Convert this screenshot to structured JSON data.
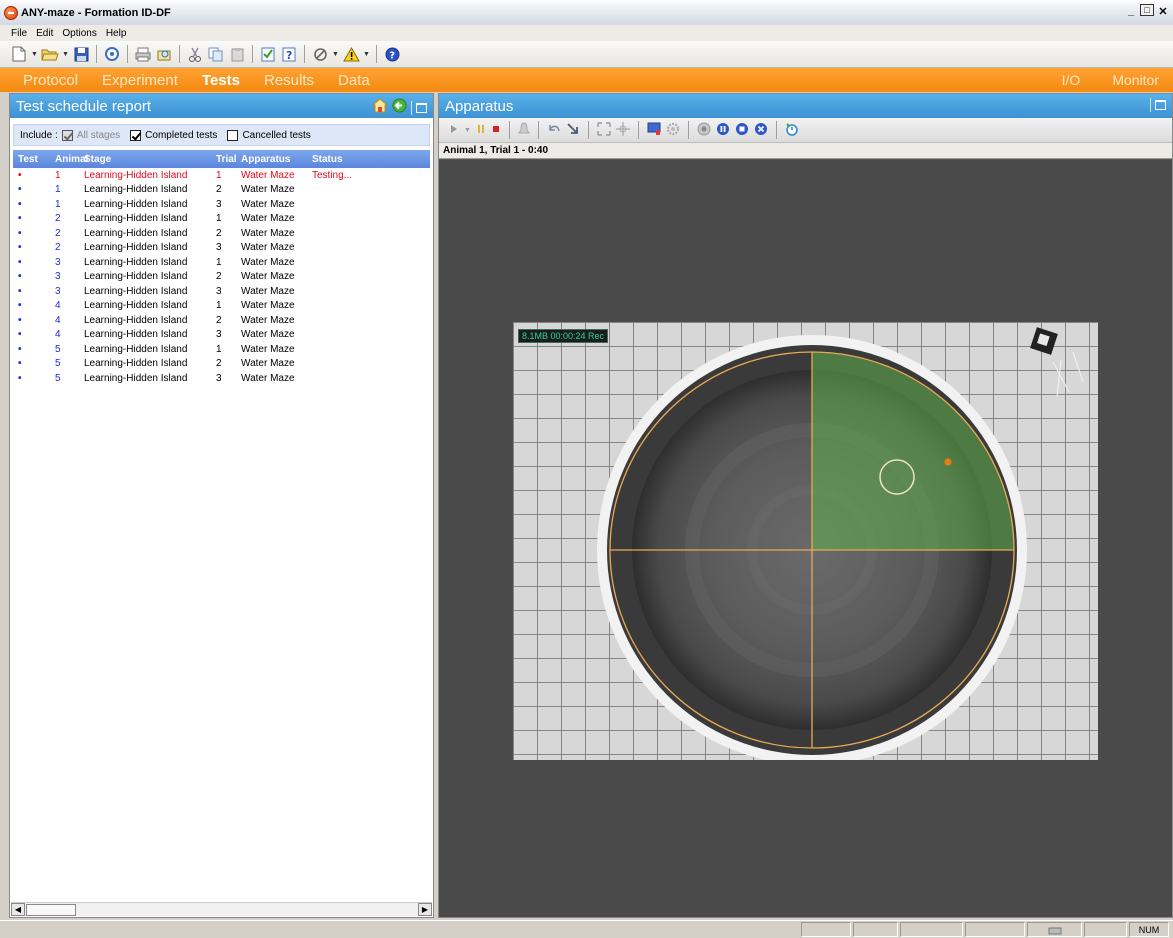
{
  "window": {
    "title": "ANY-maze - Formation ID-DF"
  },
  "menu": {
    "items": [
      "File",
      "Edit",
      "Options",
      "Help"
    ]
  },
  "nav": {
    "tabs": [
      "Protocol",
      "Experiment",
      "Tests",
      "Results",
      "Data"
    ],
    "active": "Tests",
    "right_tabs": [
      "I/O",
      "Monitor"
    ]
  },
  "left_panel": {
    "title": "Test schedule report",
    "include": {
      "label": "Include :",
      "all_stages": "All stages",
      "completed_tests": "Completed tests",
      "cancelled_tests": "Cancelled tests"
    },
    "table": {
      "headers": {
        "test": "Test",
        "animal": "Animal",
        "stage": "Stage",
        "trial": "Trial",
        "apparatus": "Apparatus",
        "status": "Status"
      },
      "rows": [
        {
          "bullet": "•",
          "animal": "1",
          "stage": "Learning-Hidden Island",
          "trial": "1",
          "apparatus": "Water Maze",
          "status": "Testing..."
        },
        {
          "bullet": "•",
          "animal": "1",
          "stage": "Learning-Hidden Island",
          "trial": "2",
          "apparatus": "Water Maze",
          "status": ""
        },
        {
          "bullet": "•",
          "animal": "1",
          "stage": "Learning-Hidden Island",
          "trial": "3",
          "apparatus": "Water Maze",
          "status": ""
        },
        {
          "bullet": "•",
          "animal": "2",
          "stage": "Learning-Hidden Island",
          "trial": "1",
          "apparatus": "Water Maze",
          "status": ""
        },
        {
          "bullet": "•",
          "animal": "2",
          "stage": "Learning-Hidden Island",
          "trial": "2",
          "apparatus": "Water Maze",
          "status": ""
        },
        {
          "bullet": "•",
          "animal": "2",
          "stage": "Learning-Hidden Island",
          "trial": "3",
          "apparatus": "Water Maze",
          "status": ""
        },
        {
          "bullet": "•",
          "animal": "3",
          "stage": "Learning-Hidden Island",
          "trial": "1",
          "apparatus": "Water Maze",
          "status": ""
        },
        {
          "bullet": "•",
          "animal": "3",
          "stage": "Learning-Hidden Island",
          "trial": "2",
          "apparatus": "Water Maze",
          "status": ""
        },
        {
          "bullet": "•",
          "animal": "3",
          "stage": "Learning-Hidden Island",
          "trial": "3",
          "apparatus": "Water Maze",
          "status": ""
        },
        {
          "bullet": "•",
          "animal": "4",
          "stage": "Learning-Hidden Island",
          "trial": "1",
          "apparatus": "Water Maze",
          "status": ""
        },
        {
          "bullet": "•",
          "animal": "4",
          "stage": "Learning-Hidden Island",
          "trial": "2",
          "apparatus": "Water Maze",
          "status": ""
        },
        {
          "bullet": "•",
          "animal": "4",
          "stage": "Learning-Hidden Island",
          "trial": "3",
          "apparatus": "Water Maze",
          "status": ""
        },
        {
          "bullet": "•",
          "animal": "5",
          "stage": "Learning-Hidden Island",
          "trial": "1",
          "apparatus": "Water Maze",
          "status": ""
        },
        {
          "bullet": "•",
          "animal": "5",
          "stage": "Learning-Hidden Island",
          "trial": "2",
          "apparatus": "Water Maze",
          "status": ""
        },
        {
          "bullet": "•",
          "animal": "5",
          "stage": "Learning-Hidden Island",
          "trial": "3",
          "apparatus": "Water Maze",
          "status": ""
        }
      ]
    }
  },
  "right_panel": {
    "title": "Apparatus",
    "status": "Animal 1, Trial 1 - 0:40",
    "video_badge": "8.1MB 00:00:24 Rec"
  },
  "statusbar": {
    "num": "NUM"
  },
  "colors": {
    "nav_orange": "#f48a10",
    "panel_blue": "#3c92d4",
    "active_row": "#e5081b",
    "quadrant_green": "#5fae4a",
    "zone_line": "#e8a955"
  }
}
